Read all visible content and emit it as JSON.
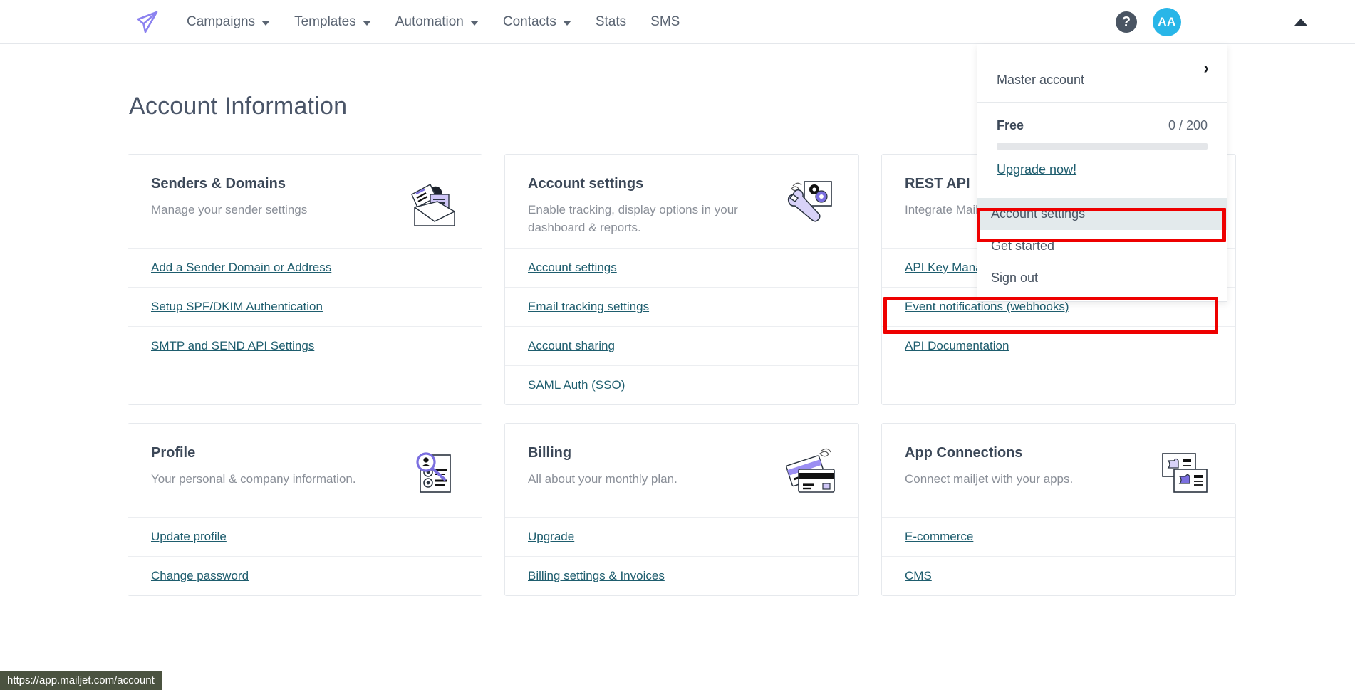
{
  "nav": {
    "logo_icon": "mailjet-paper-plane-logo",
    "items": [
      {
        "label": "Campaigns",
        "has_dropdown": true
      },
      {
        "label": "Templates",
        "has_dropdown": true
      },
      {
        "label": "Automation",
        "has_dropdown": true
      },
      {
        "label": "Contacts",
        "has_dropdown": true
      },
      {
        "label": "Stats",
        "has_dropdown": false
      },
      {
        "label": "SMS",
        "has_dropdown": false
      }
    ],
    "help_icon": "question-mark-icon",
    "help_label": "?",
    "avatar_initials": "AA",
    "avatar_color": "#29b6e8",
    "collapse_icon": "caret-up-icon"
  },
  "page": {
    "title": "Account Information"
  },
  "cards": [
    {
      "title": "Senders & Domains",
      "desc": "Manage your sender settings",
      "icon": "envelope-letter-icon",
      "links": [
        "Add a Sender Domain or Address",
        "Setup SPF/DKIM Authentication",
        "SMTP and SEND API Settings"
      ]
    },
    {
      "title": "Account settings",
      "desc": "Enable tracking, display options in your dashboard & reports.",
      "icon": "wrench-gears-icon",
      "links": [
        "Account settings",
        "Email tracking settings",
        "Account sharing",
        "SAML Auth (SSO)"
      ]
    },
    {
      "title": "REST API",
      "desc": "Integrate Mailjet in your application.",
      "icon": "code-plug-icon",
      "links": [
        "API Key Management (Primary and Sub-account)",
        "Event notifications (webhooks)",
        "API Documentation"
      ]
    },
    {
      "title": "Profile",
      "desc": "Your personal & company information.",
      "icon": "profile-magnifier-icon",
      "links": [
        "Update profile",
        "Change password"
      ]
    },
    {
      "title": "Billing",
      "desc": "All about your monthly plan.",
      "icon": "credit-cards-icon",
      "links": [
        "Upgrade",
        "Billing settings & Invoices"
      ]
    },
    {
      "title": "App Connections",
      "desc": "Connect mailjet with your apps.",
      "icon": "puzzle-cards-icon",
      "links": [
        "E-commerce",
        "CMS"
      ]
    }
  ],
  "account_menu": {
    "master_account_label": "Master account",
    "master_account_chevron": "›",
    "plan_name": "Free",
    "plan_quota": "0 / 200",
    "plan_progress_percent": 0,
    "upgrade_link": "Upgrade now!",
    "items": [
      {
        "label": "Account settings",
        "selected": true
      },
      {
        "label": "Get started",
        "selected": false
      },
      {
        "label": "Sign out",
        "selected": false
      }
    ]
  },
  "annotations": {
    "highlight_color": "#ee0000",
    "boxes": [
      {
        "name": "account-settings-menu-item"
      },
      {
        "name": "api-key-management-link"
      }
    ]
  },
  "status_bar": {
    "url": "https://app.mailjet.com/account"
  }
}
